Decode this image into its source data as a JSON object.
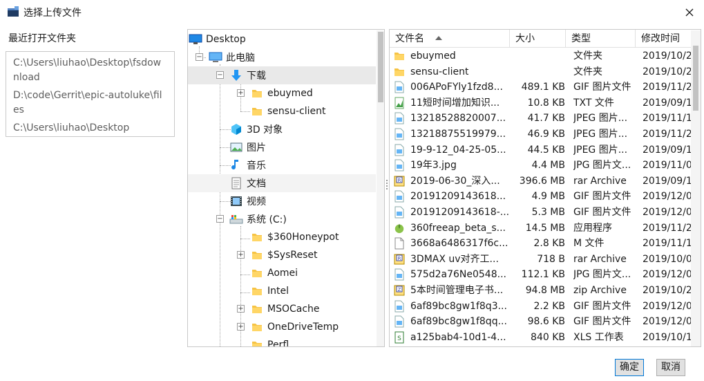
{
  "window": {
    "title": "选择上传文件"
  },
  "recent": {
    "label": "最近打开文件夹",
    "items": [
      "C:\\Users\\liuhao\\Desktop\\fsdownload",
      "D:\\code\\Gerrit\\epic-autoluke\\files",
      "C:\\Users\\liuhao\\Desktop"
    ]
  },
  "tree": {
    "items": [
      {
        "label": "Desktop",
        "icon": "desktop-icon"
      },
      {
        "label": "此电脑",
        "icon": "computer-icon"
      },
      {
        "label": "下载",
        "icon": "download-icon"
      },
      {
        "label": "ebuymed",
        "icon": "folder-icon"
      },
      {
        "label": "sensu-client",
        "icon": "folder-icon"
      },
      {
        "label": "3D 对象",
        "icon": "3d-objects-icon"
      },
      {
        "label": "图片",
        "icon": "pictures-icon"
      },
      {
        "label": "音乐",
        "icon": "music-icon"
      },
      {
        "label": "文档",
        "icon": "documents-icon"
      },
      {
        "label": "视频",
        "icon": "video-icon"
      },
      {
        "label": "系统 (C:)",
        "icon": "drive-icon"
      },
      {
        "label": "$360Honeypot",
        "icon": "folder-icon"
      },
      {
        "label": "$SysReset",
        "icon": "folder-icon"
      },
      {
        "label": "Aomei",
        "icon": "folder-icon"
      },
      {
        "label": "Intel",
        "icon": "folder-icon"
      },
      {
        "label": "MSOCache",
        "icon": "folder-icon"
      },
      {
        "label": "OneDriveTemp",
        "icon": "folder-icon"
      },
      {
        "label": "Perfl",
        "icon": "folder-icon"
      }
    ]
  },
  "list": {
    "columns": {
      "name": "文件名",
      "size": "大小",
      "type": "类型",
      "date": "修改时间"
    },
    "rows": [
      {
        "name": "ebuymed",
        "size": "",
        "type": "文件夹",
        "date": "2019/10/2",
        "icon": "folder-icon"
      },
      {
        "name": "sensu-client",
        "size": "",
        "type": "文件夹",
        "date": "2019/10/2",
        "icon": "folder-icon"
      },
      {
        "name": "006APoFYly1fzd8...",
        "size": "489.1 KB",
        "type": "GIF 图片文件",
        "date": "2019/11/2",
        "icon": "image-file-icon"
      },
      {
        "name": "11短时间增加知识...",
        "size": "10.8 KB",
        "type": "TXT 文件",
        "date": "2019/09/1",
        "icon": "text-file-icon"
      },
      {
        "name": "13218528820007...",
        "size": "41.7 KB",
        "type": "JPEG 图片...",
        "date": "2019/11/1",
        "icon": "image-file-icon"
      },
      {
        "name": "13218875519979...",
        "size": "46.9 KB",
        "type": "JPEG 图片...",
        "date": "2019/11/2",
        "icon": "image-file-icon"
      },
      {
        "name": "19-9-12_04-25-05...",
        "size": "44.5 KB",
        "type": "JPEG 图片...",
        "date": "2019/09/1",
        "icon": "image-file-icon"
      },
      {
        "name": "19年3.jpg",
        "size": "4.4 MB",
        "type": "JPG 图片文...",
        "date": "2019/11/0",
        "icon": "image-file-icon"
      },
      {
        "name": "2019-06-30_深入...",
        "size": "396.6 MB",
        "type": "rar Archive",
        "date": "2019/09/1",
        "icon": "archive-icon"
      },
      {
        "name": "20191209143618...",
        "size": "4.9 MB",
        "type": "GIF 图片文件",
        "date": "2019/12/0",
        "icon": "image-file-icon"
      },
      {
        "name": "20191209143618-...",
        "size": "5.3 MB",
        "type": "GIF 图片文件",
        "date": "2019/12/0",
        "icon": "image-file-icon"
      },
      {
        "name": "360freeap_beta_s...",
        "size": "14.5 MB",
        "type": "应用程序",
        "date": "2019/11/2",
        "icon": "app-icon"
      },
      {
        "name": "3668a6486317f6c...",
        "size": "2.8 KB",
        "type": "M 文件",
        "date": "2019/11/1",
        "icon": "blank-file-icon"
      },
      {
        "name": "3DMAX uv对齐工...",
        "size": "718 B",
        "type": "rar Archive",
        "date": "2019/10/0",
        "icon": "archive-icon"
      },
      {
        "name": "575d2a76Ne0548...",
        "size": "112.1 KB",
        "type": "JPG 图片文...",
        "date": "2019/12/0",
        "icon": "image-file-icon"
      },
      {
        "name": "5本时间管理电子书...",
        "size": "94.8 MB",
        "type": "zip Archive",
        "date": "2019/10/2",
        "icon": "zip-icon"
      },
      {
        "name": "6af89bc8gw1f8q3...",
        "size": "2.2 KB",
        "type": "GIF 图片文件",
        "date": "2019/12/0",
        "icon": "image-file-icon"
      },
      {
        "name": "6af89bc8gw1f8qq...",
        "size": "98.6 KB",
        "type": "GIF 图片文件",
        "date": "2019/12/0",
        "icon": "image-file-icon"
      },
      {
        "name": "a125bab4-10d1-4...",
        "size": "840 KB",
        "type": "XLS 工作表",
        "date": "2019/10/1",
        "icon": "spreadsheet-icon"
      }
    ]
  },
  "buttons": {
    "ok": "确定",
    "cancel": "取消"
  }
}
